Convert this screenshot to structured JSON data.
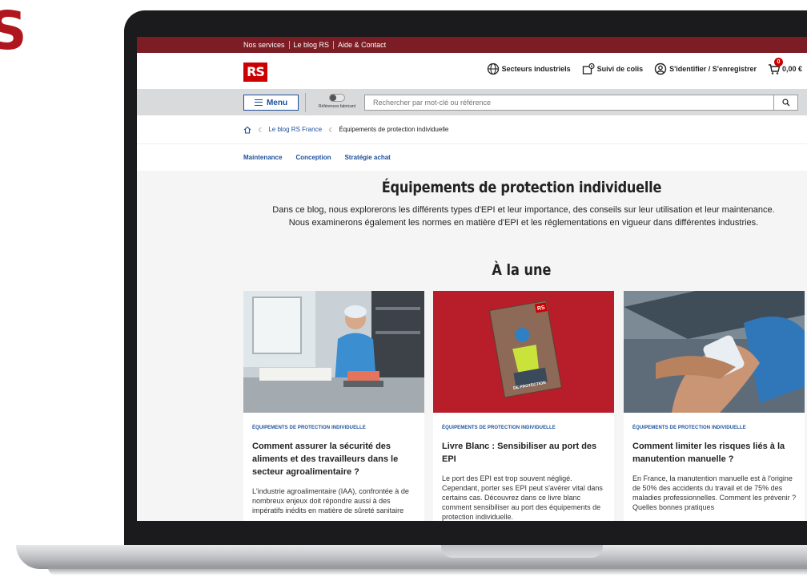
{
  "brand_letter": "S",
  "topbar": {
    "links": [
      "Nos services",
      "Le blog RS",
      "Aide & Contact"
    ]
  },
  "header": {
    "logo": "RS",
    "sectors": "Secteurs industriels",
    "tracking": "Suivi de colis",
    "account": "S'identifier / S'enregistrer",
    "cart_count": "0",
    "cart_total": "0,00 €"
  },
  "search": {
    "menu_label": "Menu",
    "toggle_label": "Références fabricant",
    "placeholder": "Rechercher par mot-clé ou référence"
  },
  "breadcrumb": {
    "blog": "Le blog RS France",
    "current": "Équipements de protection individuelle"
  },
  "subnav": [
    "Maintenance",
    "Conception",
    "Stratégie achat"
  ],
  "page": {
    "title": "Équipements de protection individuelle",
    "intro_line1": "Dans ce blog, nous explorerons les différents types d'EPI et leur importance, des conseils sur leur utilisation et leur maintenance.",
    "intro_line2": "Nous examinerons également les normes en matière d'EPI et les réglementations en vigueur dans différentes industries.",
    "featured_title": "À la une"
  },
  "cards": [
    {
      "category": "ÉQUIPEMENTS DE PROTECTION INDIVIDUELLE",
      "title": "Comment assurer la sécurité des aliments et des travailleurs dans le secteur agroalimentaire ?",
      "text": "L'industrie agroalimentaire (IAA), confrontée à de nombreux enjeux doit répondre aussi à des impératifs inédits en matière de sûreté sanitaire"
    },
    {
      "category": "ÉQUIPEMENTS DE PROTECTION INDIVIDUELLE",
      "title": "Livre Blanc : Sensibiliser au port des EPI",
      "text": "Le port des EPI est trop souvent négligé. Cependant, porter ses EPI peut s'avérer vital dans certains cas. Découvrez dans ce livre blanc comment sensibiliser au port des équipements de protection individuelle.",
      "book_logo": "RS",
      "book_caption": "DE PROTECTION"
    },
    {
      "category": "ÉQUIPEMENTS DE PROTECTION INDIVIDUELLE",
      "title": "Comment limiter les risques liés à la manutention manuelle ?",
      "text": "En France, la manutention manuelle est à l'origine de 50% des accidents du travail et de 75% des maladies professionnelles. Comment les prévenir ? Quelles bonnes pratiques"
    }
  ],
  "colors": {
    "brand_red": "#cc0000",
    "topbar": "#7c1d25",
    "link_blue": "#1a4f9c"
  }
}
